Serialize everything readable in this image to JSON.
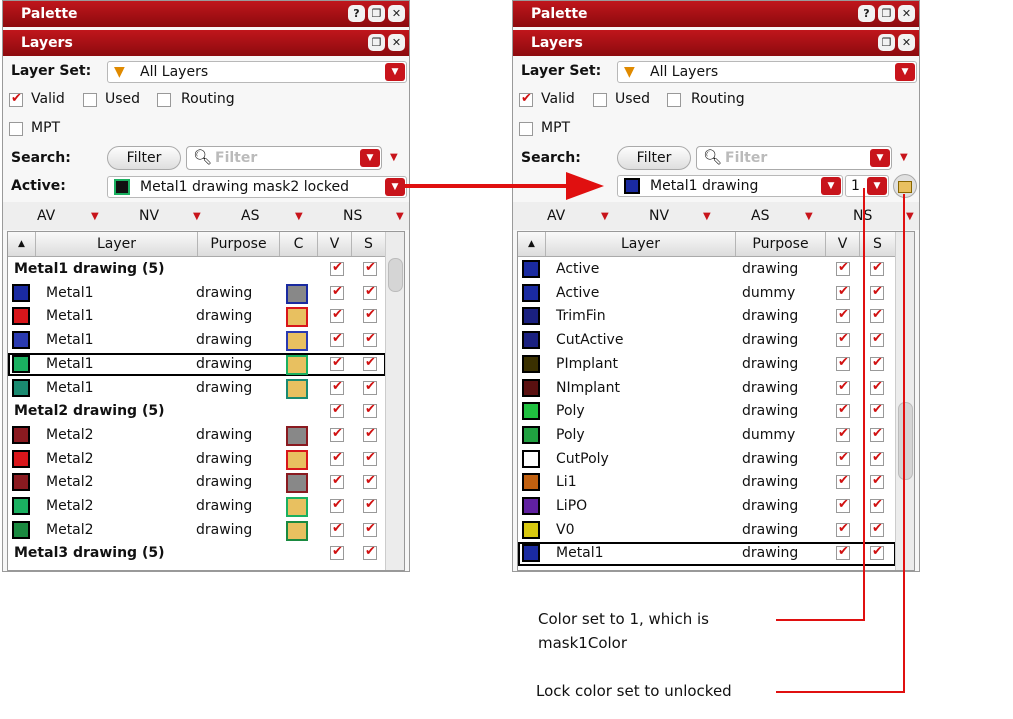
{
  "left": {
    "palette_title": "Palette",
    "layers_title": "Layers",
    "layer_set_label": "Layer Set:",
    "layer_set_value": "All Layers",
    "checks": [
      {
        "label": "Valid",
        "checked": true
      },
      {
        "label": "Used",
        "checked": false
      },
      {
        "label": "Routing",
        "checked": false
      },
      {
        "label": "MPT",
        "checked": false
      }
    ],
    "search_label": "Search:",
    "filter_button": "Filter",
    "search_placeholder": "Filter",
    "active_label": "Active:",
    "active_value": "Metal1 drawing mask2 locked",
    "visibility": [
      "AV",
      "NV",
      "AS",
      "NS"
    ],
    "columns": [
      "Layer",
      "Purpose",
      "C",
      "V",
      "S"
    ],
    "rows": [
      {
        "group": "Metal1 drawing (5)"
      },
      {
        "layer": "Metal1",
        "purpose": "drawing",
        "color": "#1a2aa0"
      },
      {
        "layer": "Metal1",
        "purpose": "drawing",
        "color": "#d8161b"
      },
      {
        "layer": "Metal1",
        "purpose": "drawing",
        "color": "#2a3ab0"
      },
      {
        "layer": "Metal1",
        "purpose": "drawing",
        "color": "#1ab060",
        "selected": true
      },
      {
        "layer": "Metal1",
        "purpose": "drawing",
        "color": "#1a8a70"
      },
      {
        "group": "Metal2 drawing (5)"
      },
      {
        "layer": "Metal2",
        "purpose": "drawing",
        "color": "#8a1a20"
      },
      {
        "layer": "Metal2",
        "purpose": "drawing",
        "color": "#d8161b"
      },
      {
        "layer": "Metal2",
        "purpose": "drawing",
        "color": "#8a1a20"
      },
      {
        "layer": "Metal2",
        "purpose": "drawing",
        "color": "#1ab060"
      },
      {
        "layer": "Metal2",
        "purpose": "drawing",
        "color": "#1a8a40"
      },
      {
        "group": "Metal3 drawing (5)"
      }
    ]
  },
  "right": {
    "palette_title": "Palette",
    "layers_title": "Layers",
    "layer_set_label": "Layer Set:",
    "layer_set_value": "All Layers",
    "checks": [
      {
        "label": "Valid",
        "checked": true
      },
      {
        "label": "Used",
        "checked": false
      },
      {
        "label": "Routing",
        "checked": false
      },
      {
        "label": "MPT",
        "checked": false
      }
    ],
    "search_label": "Search:",
    "filter_button": "Filter",
    "search_placeholder": "Filter",
    "active_value": "Metal1 drawing",
    "color_value": "1",
    "visibility": [
      "AV",
      "NV",
      "AS",
      "NS"
    ],
    "columns": [
      "Layer",
      "Purpose",
      "V",
      "S"
    ],
    "rows": [
      {
        "layer": "Active",
        "purpose": "drawing",
        "color": "#1a2aa0"
      },
      {
        "layer": "Active",
        "purpose": "dummy",
        "color": "#1a2aa0"
      },
      {
        "layer": "TrimFin",
        "purpose": "drawing",
        "color": "#1a2080"
      },
      {
        "layer": "CutActive",
        "purpose": "drawing",
        "color": "#1a2080"
      },
      {
        "layer": "PImplant",
        "purpose": "drawing",
        "color": "#3a3000"
      },
      {
        "layer": "NImplant",
        "purpose": "drawing",
        "color": "#5a1010"
      },
      {
        "layer": "Poly",
        "purpose": "drawing",
        "color": "#20c040"
      },
      {
        "layer": "Poly",
        "purpose": "dummy",
        "color": "#20a040"
      },
      {
        "layer": "CutPoly",
        "purpose": "drawing",
        "color": "#ffffff"
      },
      {
        "layer": "Li1",
        "purpose": "drawing",
        "color": "#c06010"
      },
      {
        "layer": "LiPO",
        "purpose": "drawing",
        "color": "#6020a0"
      },
      {
        "layer": "V0",
        "purpose": "drawing",
        "color": "#d8c810"
      },
      {
        "layer": "Metal1",
        "purpose": "drawing",
        "color": "#1a2aa0",
        "selected": true
      }
    ]
  },
  "annotations": {
    "color_note": "Color set to 1, which is mask1Color",
    "lock_note": "Lock color set to unlocked"
  }
}
